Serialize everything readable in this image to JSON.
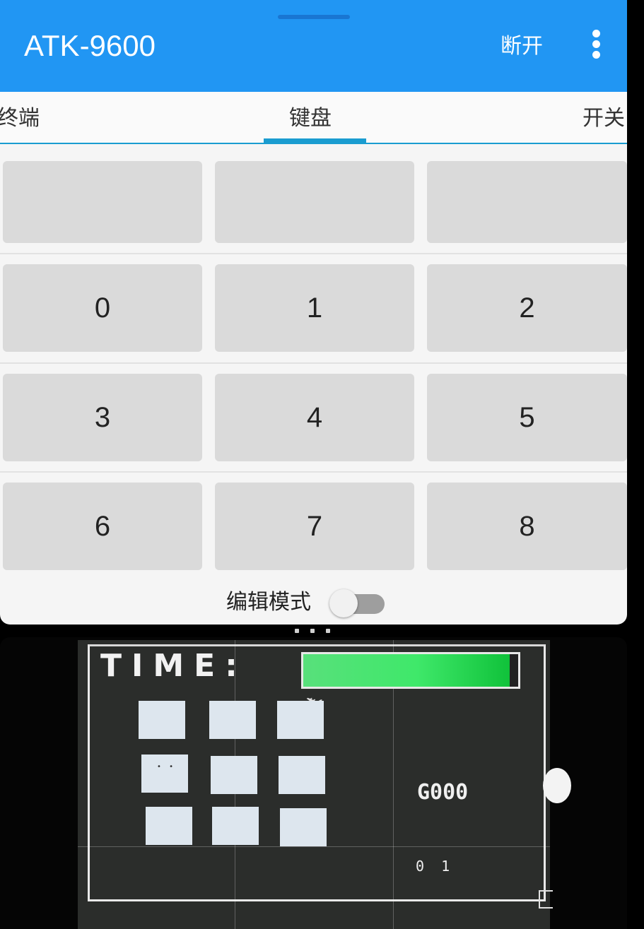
{
  "app_bar": {
    "title": "ATK-9600",
    "disconnect_label": "断开",
    "menu_icon": "more-vert-icon",
    "color": "#2196f3"
  },
  "tabs": [
    {
      "label": "终端",
      "selected": false
    },
    {
      "label": "键盘",
      "selected": true
    },
    {
      "label": "开关",
      "selected": false
    }
  ],
  "accent_color": "#1a9cd0",
  "keypad": {
    "rows": [
      [
        "",
        "",
        ""
      ],
      [
        "0",
        "1",
        "2"
      ],
      [
        "3",
        "4",
        "5"
      ],
      [
        "6",
        "7",
        "8"
      ]
    ]
  },
  "edit_mode": {
    "label": "编辑模式",
    "enabled": false
  },
  "camera_feed": {
    "lcd_title": "TIME:",
    "timer_bar_fraction": 0.96,
    "timer_bar_color": "#3fe86a",
    "score_text": "G000",
    "coords_text": "0 1",
    "tile_grid": "3x3"
  }
}
